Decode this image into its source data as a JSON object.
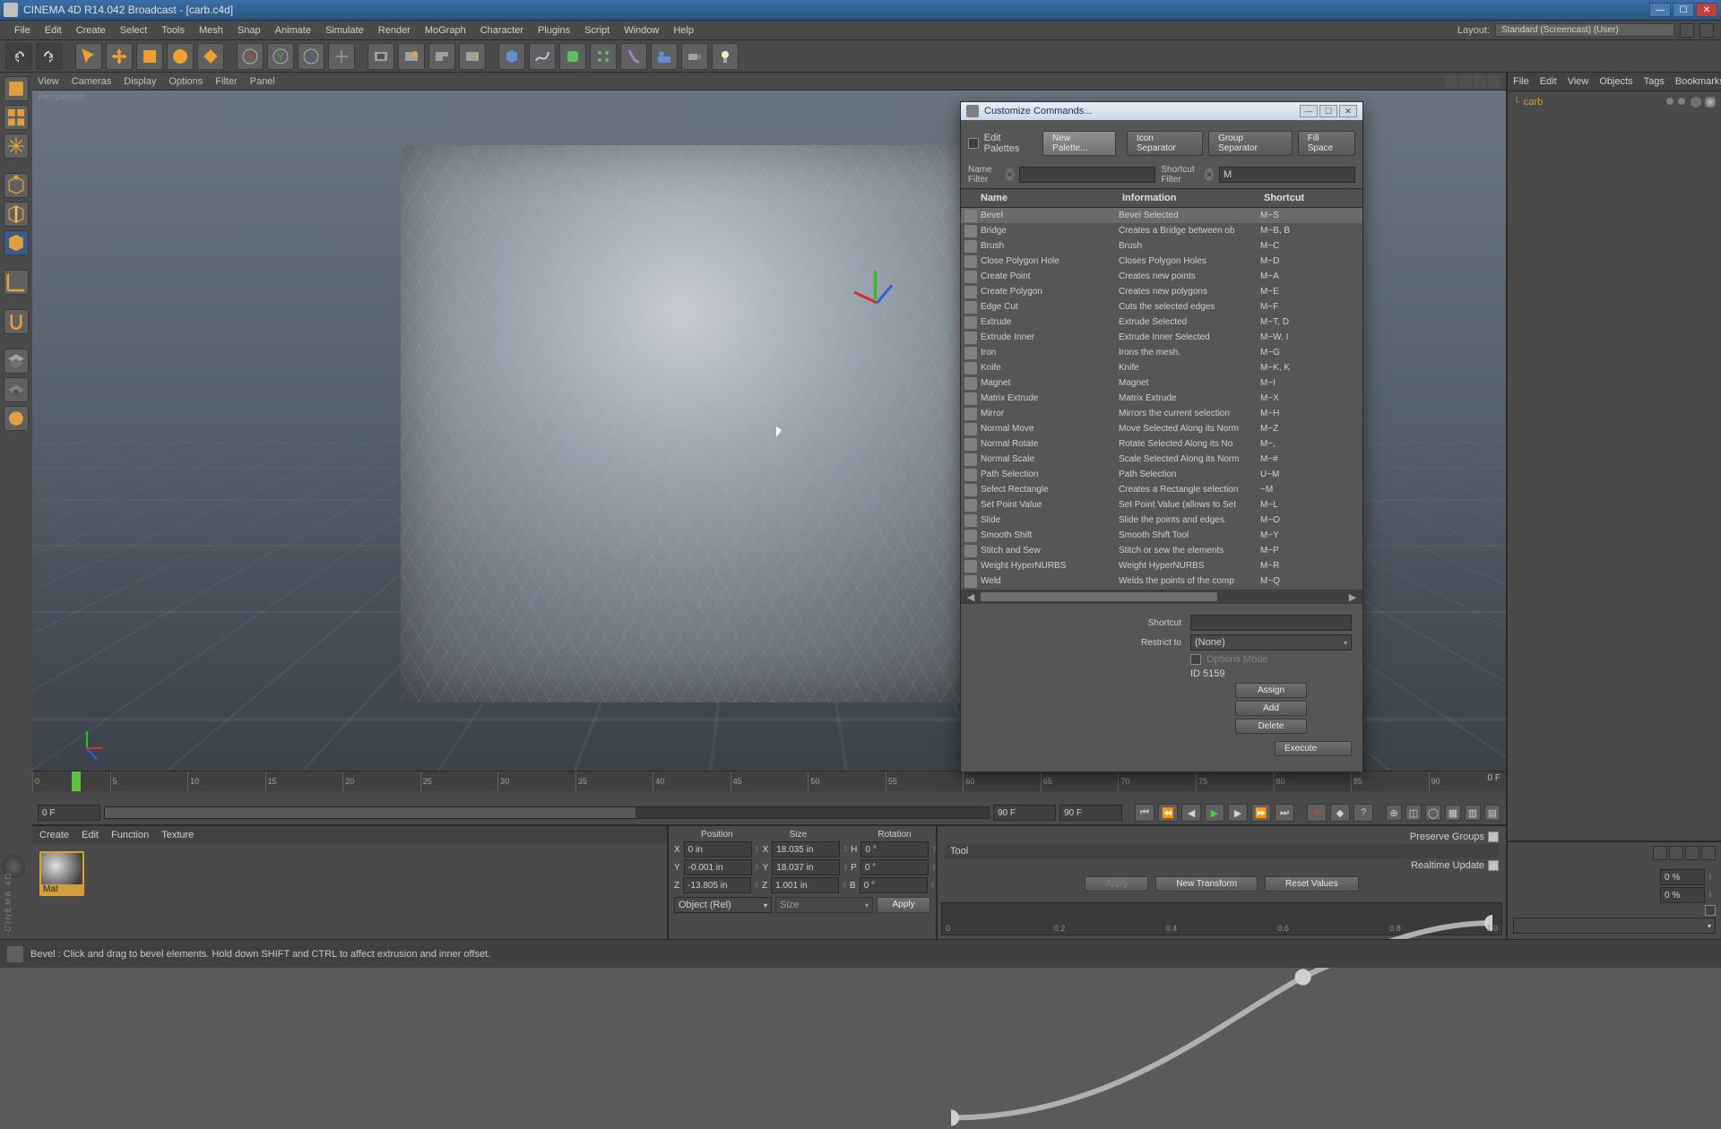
{
  "title": "CINEMA 4D R14.042 Broadcast - [carb.c4d]",
  "menubar": [
    "File",
    "Edit",
    "Create",
    "Select",
    "Tools",
    "Mesh",
    "Snap",
    "Animate",
    "Simulate",
    "Render",
    "MoGraph",
    "Character",
    "Plugins",
    "Script",
    "Window",
    "Help"
  ],
  "layout": {
    "label": "Layout:",
    "value": "Standard (Screencast) (User)"
  },
  "viewport_menus": [
    "View",
    "Cameras",
    "Display",
    "Options",
    "Filter",
    "Panel"
  ],
  "viewport_label": "Perspective",
  "object_manager": {
    "tabs": [
      "File",
      "Edit",
      "View",
      "Objects",
      "Tags",
      "Bookmarks"
    ],
    "item": {
      "name": "carb"
    }
  },
  "customize": {
    "title": "Customize Commands...",
    "edit_palettes": "Edit Palettes",
    "new_palette": "New Palette...",
    "icon_sep": "Icon Separator",
    "group_sep": "Group Separator",
    "fill_space": "Fill Space",
    "name_filter_label": "Name Filter",
    "shortcut_filter_label": "Shortcut Filter",
    "shortcut_filter_value": "M",
    "headers": {
      "name": "Name",
      "info": "Information",
      "sc": "Shortcut"
    },
    "rows": [
      {
        "n": "Bevel",
        "i": "Bevel Selected",
        "s": "M~S"
      },
      {
        "n": "Bridge",
        "i": "Creates a Bridge between ob",
        "s": "M~B, B"
      },
      {
        "n": "Brush",
        "i": "Brush",
        "s": "M~C"
      },
      {
        "n": "Close Polygon Hole",
        "i": "Closes Polygon Holes",
        "s": "M~D"
      },
      {
        "n": "Create Point",
        "i": "Creates new points",
        "s": "M~A"
      },
      {
        "n": "Create Polygon",
        "i": "Creates new polygons",
        "s": "M~E"
      },
      {
        "n": "Edge Cut",
        "i": "Cuts the selected edges",
        "s": "M~F"
      },
      {
        "n": "Extrude",
        "i": "Extrude Selected",
        "s": "M~T, D"
      },
      {
        "n": "Extrude Inner",
        "i": "Extrude Inner Selected",
        "s": "M~W, I"
      },
      {
        "n": "Iron",
        "i": "Irons the mesh.",
        "s": "M~G"
      },
      {
        "n": "Knife",
        "i": "Knife",
        "s": "M~K, K"
      },
      {
        "n": "Magnet",
        "i": "Magnet",
        "s": "M~I"
      },
      {
        "n": "Matrix Extrude",
        "i": "Matrix Extrude",
        "s": "M~X"
      },
      {
        "n": "Mirror",
        "i": "Mirrors the current selection",
        "s": "M~H"
      },
      {
        "n": "Normal Move",
        "i": "Move Selected Along its Norm",
        "s": "M~Z"
      },
      {
        "n": "Normal Rotate",
        "i": "Rotate Selected Along its No",
        "s": "M~,"
      },
      {
        "n": "Normal Scale",
        "i": "Scale Selected Along its Norm",
        "s": "M~#"
      },
      {
        "n": "Path Selection",
        "i": "Path Selection",
        "s": "U~M"
      },
      {
        "n": "Select Rectangle",
        "i": "Creates a Rectangle selection",
        "s": "~M"
      },
      {
        "n": "Set Point Value",
        "i": "Set Point Value (allows to Set",
        "s": "M~L"
      },
      {
        "n": "Slide",
        "i": "Slide the points and edges.",
        "s": "M~O"
      },
      {
        "n": "Smooth Shift",
        "i": "Smooth Shift Tool",
        "s": "M~Y"
      },
      {
        "n": "Stitch and Sew",
        "i": "Stitch or sew the elements",
        "s": "M~P"
      },
      {
        "n": "Weight HyperNURBS",
        "i": "Weight HyperNURBS",
        "s": "M~R"
      },
      {
        "n": "Weld",
        "i": "Welds the points of the comp",
        "s": "M~Q"
      }
    ],
    "shortcut_label": "Shortcut",
    "restrict_label": "Restrict to",
    "restrict_value": "(None)",
    "options_mode": "Options Mode",
    "id_label": "ID 5159",
    "assign": "Assign",
    "add": "Add",
    "delete": "Delete",
    "execute": "Execute"
  },
  "timeline": {
    "start": "0 F",
    "end": "90 F",
    "end2": "90 F",
    "ticks": [
      "0",
      "5",
      "10",
      "15",
      "20",
      "25",
      "30",
      "35",
      "40",
      "45",
      "50",
      "55",
      "60",
      "65",
      "70",
      "75",
      "80",
      "85",
      "90"
    ],
    "frame_display": "0 F"
  },
  "materials": {
    "tabs": [
      "Create",
      "Edit",
      "Function",
      "Texture"
    ],
    "swatch_label": "Mat"
  },
  "psr": {
    "headers": [
      "Position",
      "Size",
      "Rotation"
    ],
    "rows": [
      {
        "l": "X",
        "p": "0 in",
        "s": "18.035 in",
        "r": "0 °",
        "a": "H"
      },
      {
        "l": "Y",
        "p": "-0.001 in",
        "s": "18.037 in",
        "r": "0 °",
        "a": "P"
      },
      {
        "l": "Z",
        "p": "-13.805 in",
        "s": "1.001 in",
        "r": "0 °",
        "a": "B"
      }
    ],
    "mode": "Object (Rel)",
    "size_mode": "Size",
    "apply": "Apply"
  },
  "attributes": {
    "preserve": "Preserve Groups",
    "tool": "Tool",
    "realtime": "Realtime Update",
    "pct1": "0 %",
    "pct2": "0 %",
    "curve_ticks": [
      "0",
      "0.2",
      "0.4",
      "0.6",
      "0.8",
      "1.0"
    ],
    "apply": "Apply",
    "new_transform": "New Transform",
    "reset": "Reset Values"
  },
  "status": "Bevel : Click and drag to bevel elements. Hold down SHIFT and CTRL to affect extrusion and inner offset.",
  "brand": "CINEMA 4D"
}
